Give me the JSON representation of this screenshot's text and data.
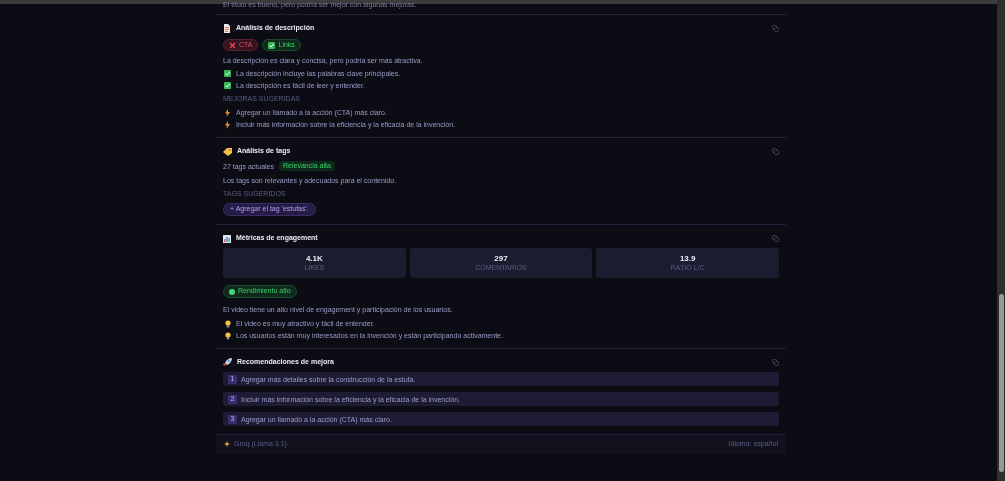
{
  "intro_text": "El título es bueno, pero podría ser mejor con algunas mejoras.",
  "sections": [
    {
      "kind": "description",
      "title": "Análisis de descripción",
      "badges": [
        {
          "label": "CTA",
          "ok": false
        },
        {
          "label": "Links",
          "ok": true
        }
      ],
      "summary": "La descripción es clara y concisa, pero podría ser más atractiva.",
      "points": [
        "La descripción incluye las palabras clave principales.",
        "La descripción es fácil de leer y entender."
      ],
      "suggestions_label": "MEJORAS SUGERIDAS",
      "suggestions": [
        "Agregar un llamado a la acción (CTA) más claro.",
        "Incluir más información sobre la eficiencia y la eficacia de la invención."
      ]
    },
    {
      "kind": "tags",
      "title": "Análisis de tags",
      "tag_count": "27 tags actuales",
      "relevance": "Relevancia alta",
      "summary": "Los tags son relevantes y adecuados para el contenido.",
      "suggestions_label": "TAGS SUGERIDOS",
      "suggested_tags": [
        "+ Agregar el tag 'estufas'."
      ]
    },
    {
      "kind": "metrics",
      "title": "Métricas de engagement",
      "stats": [
        {
          "value": "4.1K",
          "label": "LIKES"
        },
        {
          "value": "297",
          "label": "COMENTARIOS"
        },
        {
          "value": "13.9",
          "label": "RATIO L/C"
        }
      ],
      "performance": "Rendimiento alto",
      "summary": "El video tiene un alto nivel de engagement y participación de los usuarios.",
      "insights": [
        "El video es muy atractivo y fácil de entender.",
        "Los usuarios están muy interesados en la invención y están participando activamente."
      ]
    },
    {
      "kind": "recommendations",
      "title": "Recomendaciones de mejora",
      "items": [
        {
          "number": "1",
          "text": "Agregar más detalles sobre la construcción de la estufa."
        },
        {
          "number": "2",
          "text": "Incluir más información sobre la eficiencia y la eficacia de la invención."
        },
        {
          "number": "3",
          "text": "Agregar un llamado a la acción (CTA) más claro."
        }
      ]
    }
  ],
  "footer": {
    "model": "Groq (Llama 3.1)",
    "language": "Idioma: español"
  }
}
